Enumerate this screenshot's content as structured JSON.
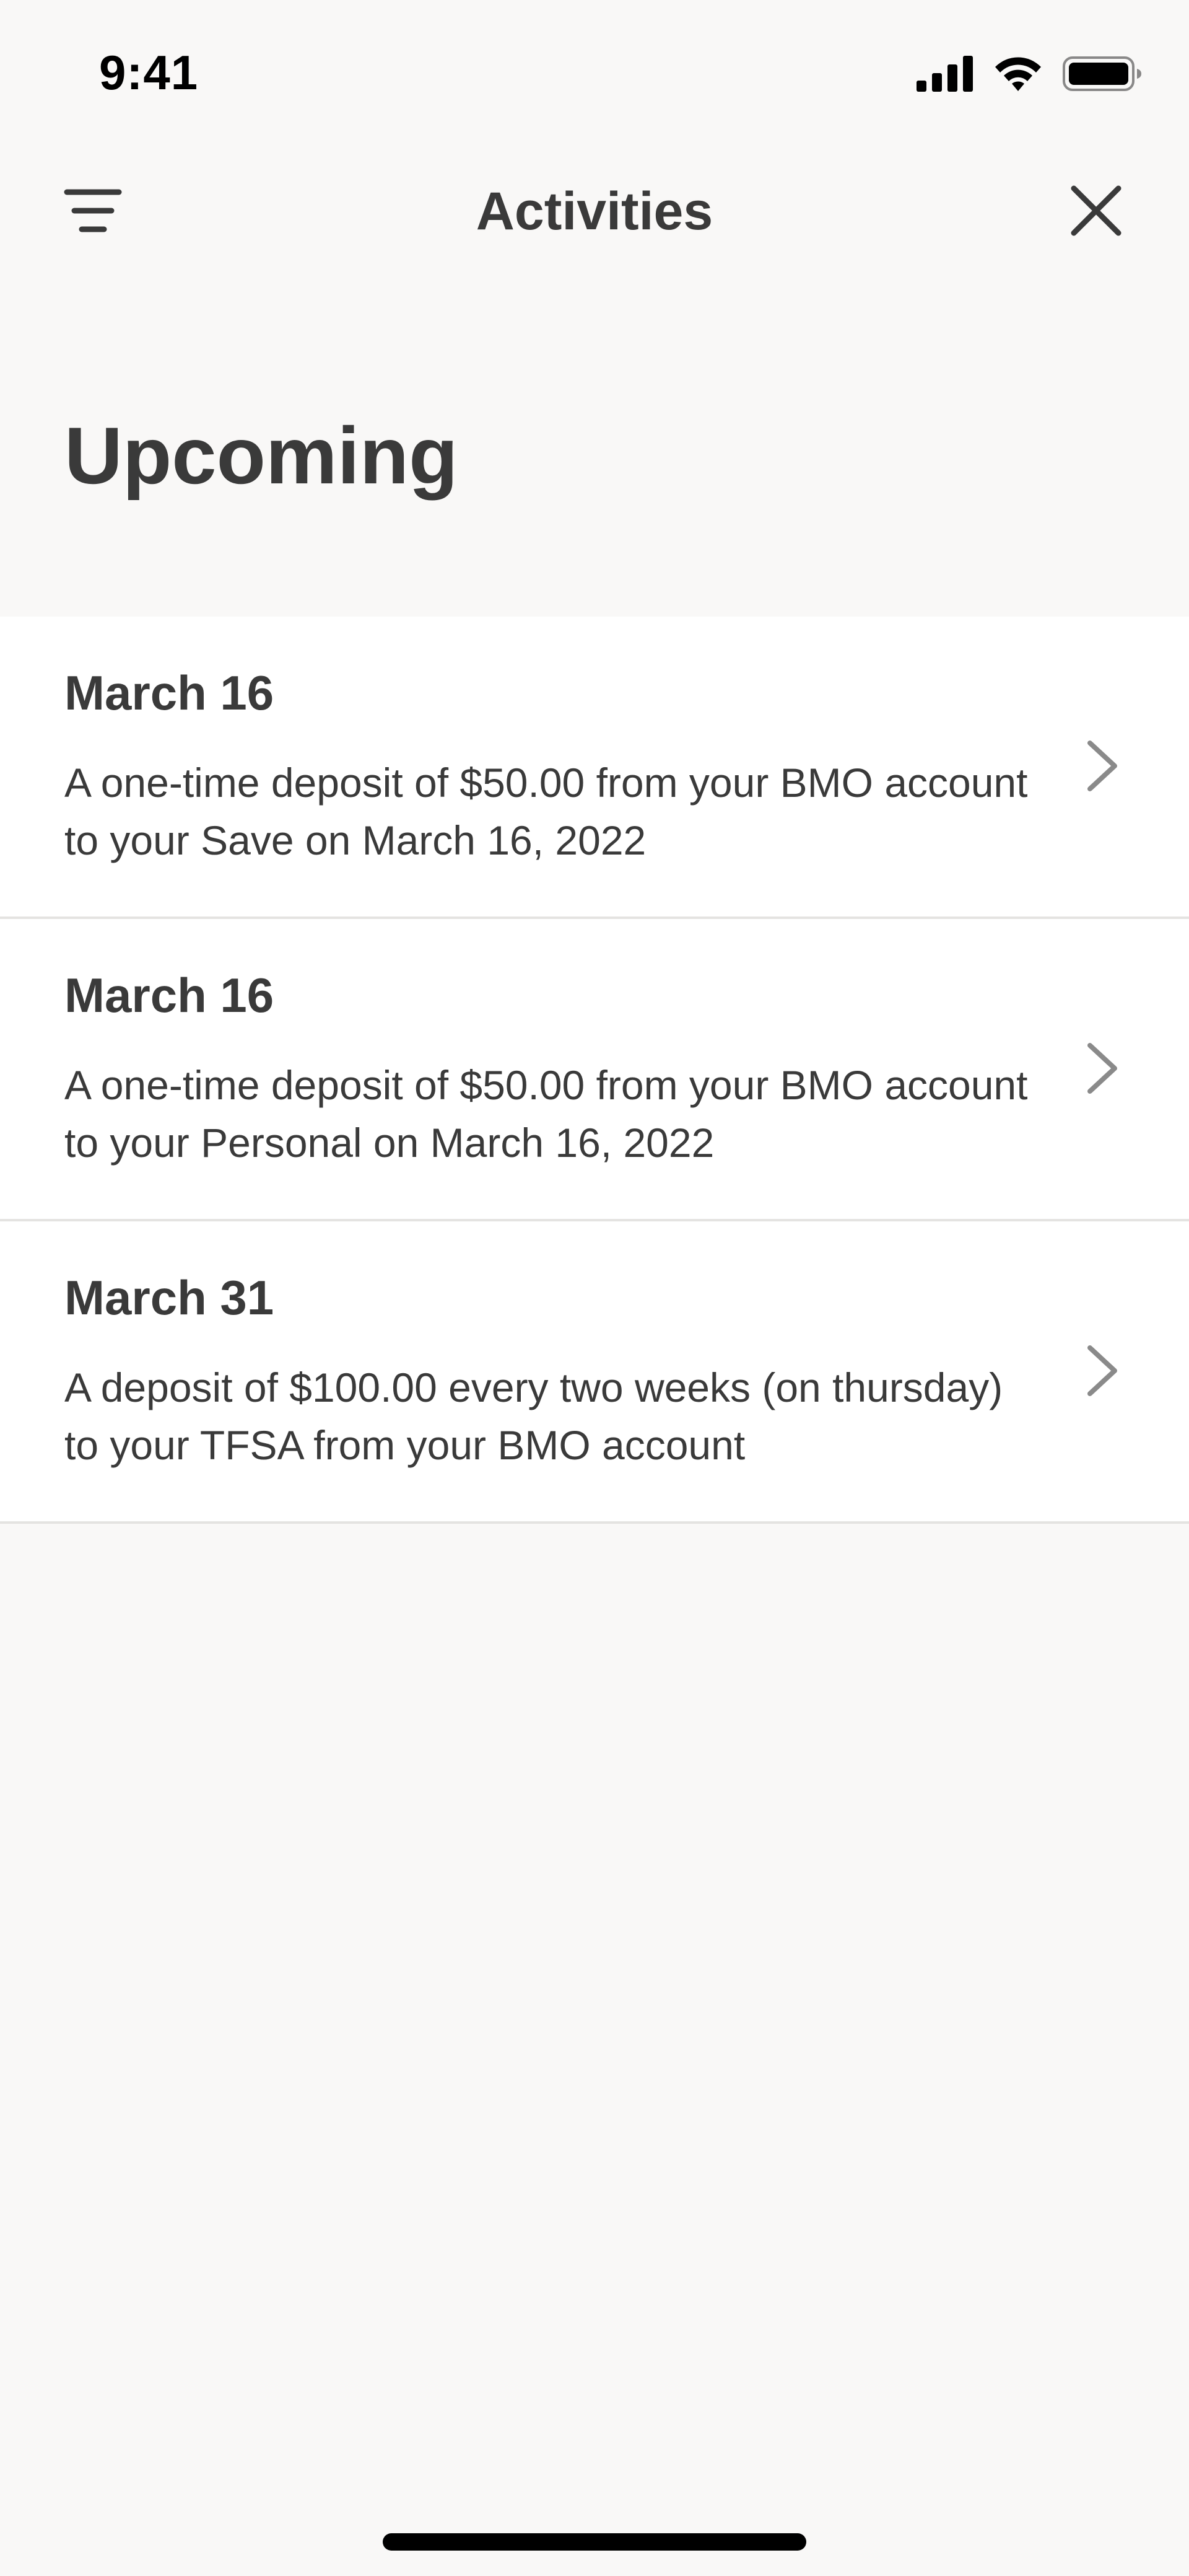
{
  "status_bar": {
    "time": "9:41",
    "icons": [
      "cellular-signal-icon",
      "wifi-icon",
      "battery-icon"
    ]
  },
  "nav": {
    "title": "Activities",
    "left_icon": "filter-icon",
    "right_icon": "close-icon"
  },
  "section": {
    "heading": "Upcoming"
  },
  "activities": [
    {
      "date": "March 16",
      "description": "A one-time deposit of $50.00 from your BMO account to your Save on March 16, 2022"
    },
    {
      "date": "March 16",
      "description": "A one-time deposit of $50.00 from your BMO account to your Personal on March 16, 2022"
    },
    {
      "date": "March 31",
      "description": "A deposit of $100.00 every two weeks (on thursday) to your TFSA from your BMO account"
    }
  ],
  "colors": {
    "background": "#f9f8f7",
    "card": "#ffffff",
    "text": "#3a3a3a",
    "divider": "#e4e3e1",
    "chevron": "#8a8a8a"
  }
}
